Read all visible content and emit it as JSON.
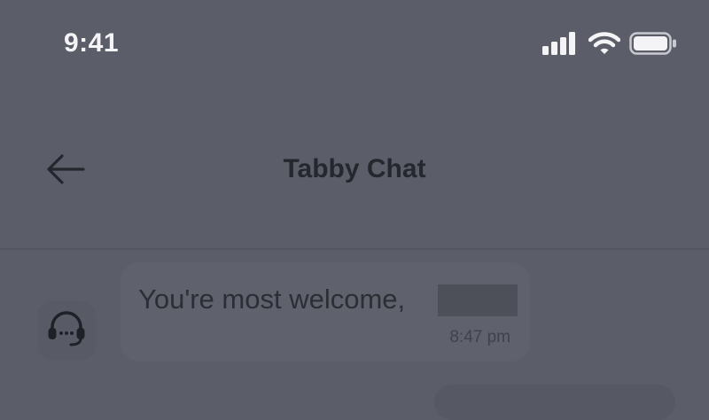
{
  "status_bar": {
    "time": "9:41",
    "icons": [
      "signal-icon",
      "wifi-icon",
      "battery-icon"
    ]
  },
  "header": {
    "title": "Tabby Chat",
    "back_icon": "arrow-left-icon"
  },
  "messages": [
    {
      "sender": "agent",
      "avatar_icon": "headset-agent-icon",
      "text": "You're most welcome,",
      "time": "8:47 pm"
    }
  ],
  "colors": {
    "overlay_background": "#5b5e68",
    "status_text": "#f4f4f6",
    "title_text": "#25272e"
  }
}
